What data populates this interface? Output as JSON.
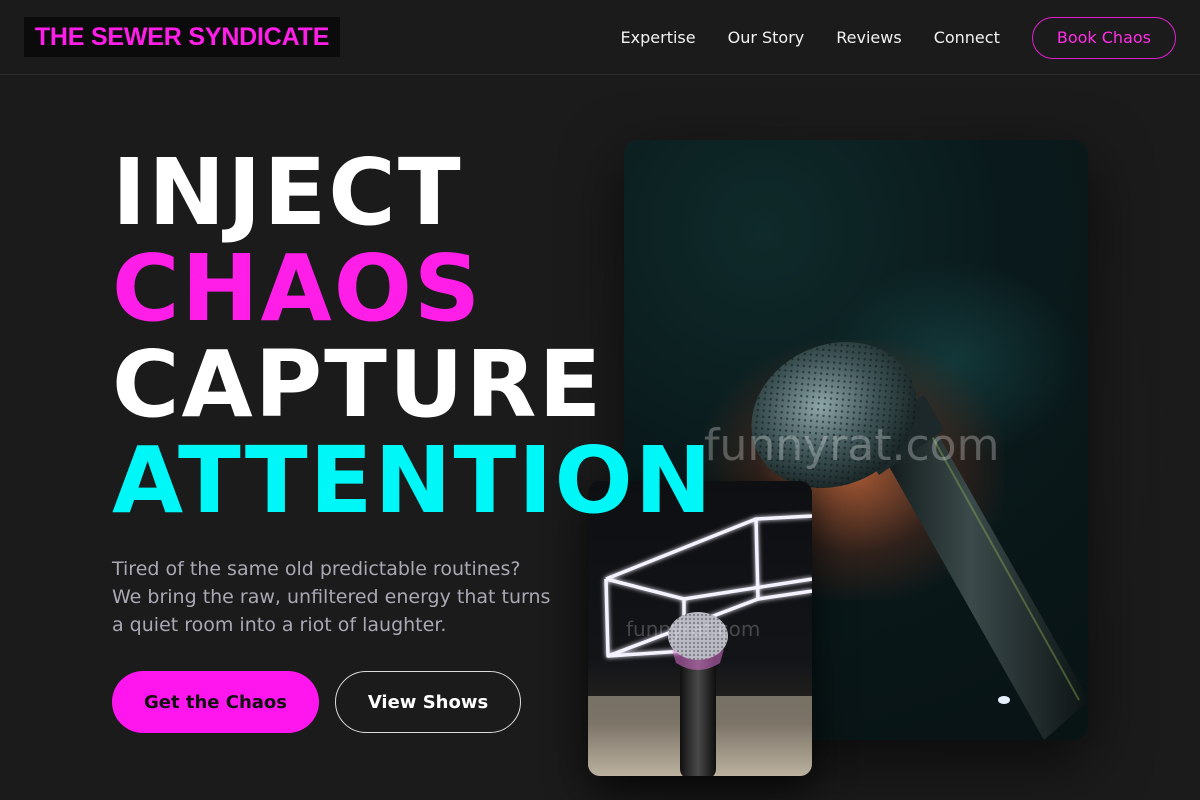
{
  "brand": {
    "name": "THE SEWER SYNDICATE"
  },
  "nav": {
    "links": [
      "Expertise",
      "Our Story",
      "Reviews",
      "Connect"
    ],
    "cta": "Book Chaos"
  },
  "hero": {
    "headline": [
      "INJECT",
      "CHAOS",
      "CAPTURE",
      "ATTENTION"
    ],
    "tagline": "Tired of the same old predictable routines? We bring the raw, unfiltered energy that turns a quiet room into a riot of laughter.",
    "primary_button": "Get the Chaos",
    "secondary_button": "View Shows"
  },
  "images": {
    "large": {
      "icon": "microphone-photo",
      "watermark": "funnyrat.com"
    },
    "small": {
      "icon": "neon-microphone-photo",
      "watermark": "funnyrat.com"
    }
  },
  "colors": {
    "accent_magenta": "#ff1ee8",
    "accent_cyan": "#00f7f7",
    "background": "#1b1b1b"
  }
}
